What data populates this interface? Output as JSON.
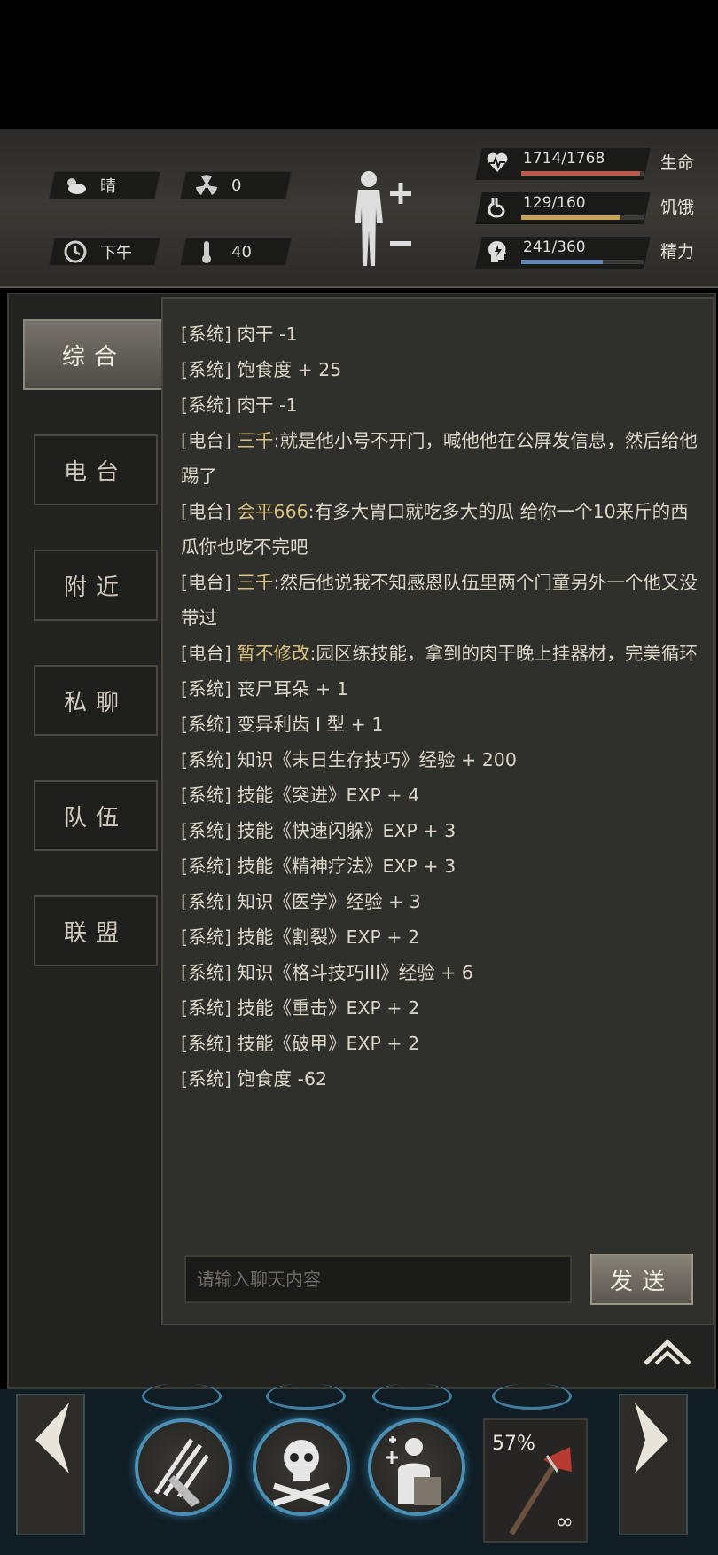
{
  "status": {
    "weather": "晴",
    "radiation": "0",
    "time_of_day": "下午",
    "temperature": "40"
  },
  "stats": [
    {
      "value": "1714/1768",
      "label": "生命",
      "fraction": 0.97,
      "color": "#c0584a",
      "icon": "heart-pulse-icon"
    },
    {
      "value": "129/160",
      "label": "饥饿",
      "fraction": 0.81,
      "color": "#c9a25a",
      "icon": "stomach-icon"
    },
    {
      "value": "241/360",
      "label": "精力",
      "fraction": 0.67,
      "color": "#5f86b8",
      "icon": "head-energy-icon"
    }
  ],
  "tabs": [
    {
      "label": "综合",
      "active": true
    },
    {
      "label": "电台",
      "active": false
    },
    {
      "label": "附近",
      "active": false
    },
    {
      "label": "私聊",
      "active": false
    },
    {
      "label": "队伍",
      "active": false
    },
    {
      "label": "联盟",
      "active": false
    }
  ],
  "messages": [
    {
      "channel": "[系统]",
      "nick": "",
      "text": "肉干 -1"
    },
    {
      "channel": "[系统]",
      "nick": "",
      "text": "饱食度 + 25"
    },
    {
      "channel": "[系统]",
      "nick": "",
      "text": "肉干 -1"
    },
    {
      "channel": "[电台]",
      "nick": "三千",
      "text": ":就是他小号不开门，喊他他在公屏发信息，然后给他踢了"
    },
    {
      "channel": "[电台]",
      "nick": "会平666",
      "text": ":有多大胃口就吃多大的瓜 给你一个10来斤的西瓜你也吃不完吧"
    },
    {
      "channel": "[电台]",
      "nick": "三千",
      "text": ":然后他说我不知感恩队伍里两个门童另外一个他又没带过"
    },
    {
      "channel": "[电台]",
      "nick": "暂不修改",
      "text": ":园区练技能，拿到的肉干晚上挂器材，完美循环"
    },
    {
      "channel": "[系统]",
      "nick": "",
      "text": "丧尸耳朵 + 1"
    },
    {
      "channel": "[系统]",
      "nick": "",
      "text": "变异利齿 I 型 + 1"
    },
    {
      "channel": "[系统]",
      "nick": "",
      "text": "知识《末日生存技巧》经验 + 200"
    },
    {
      "channel": "[系统]",
      "nick": "",
      "text": "技能《突进》EXP + 4"
    },
    {
      "channel": "[系统]",
      "nick": "",
      "text": "技能《快速闪躲》EXP + 3"
    },
    {
      "channel": "[系统]",
      "nick": "",
      "text": "技能《精神疗法》EXP + 3"
    },
    {
      "channel": "[系统]",
      "nick": "",
      "text": "知识《医学》经验 + 3"
    },
    {
      "channel": "[系统]",
      "nick": "",
      "text": "技能《割裂》EXP + 2"
    },
    {
      "channel": "[系统]",
      "nick": "",
      "text": "知识《格斗技巧III》经验 + 6"
    },
    {
      "channel": "[系统]",
      "nick": "",
      "text": "技能《重击》EXP + 2"
    },
    {
      "channel": "[系统]",
      "nick": "",
      "text": "技能《破甲》EXP + 2"
    },
    {
      "channel": "[系统]",
      "nick": "",
      "text": "饱食度 -62"
    }
  ],
  "input": {
    "placeholder": "请输入聊天内容",
    "value": ""
  },
  "send_label": "发送",
  "weapon": {
    "durability": "57%",
    "ammo": "∞"
  }
}
